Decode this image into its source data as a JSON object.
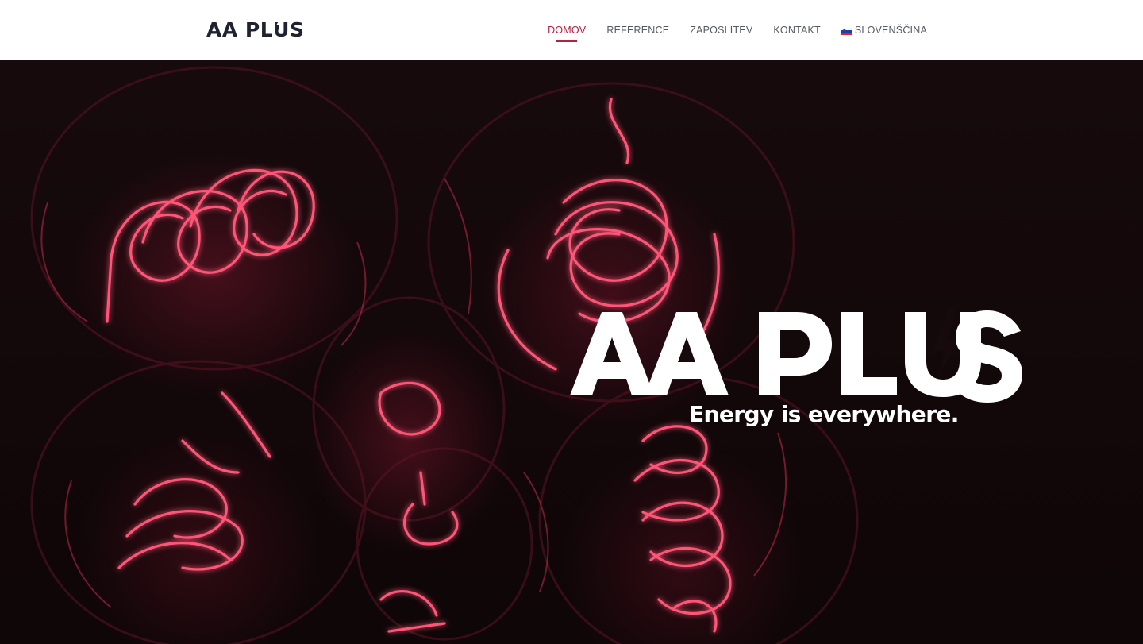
{
  "header": {
    "logo": {
      "part1": "AA PL",
      "part2": "S",
      "accent_letter": "U"
    },
    "nav": [
      {
        "label": "DOMOV",
        "active": true
      },
      {
        "label": "REFERENCE",
        "active": false
      },
      {
        "label": "ZAPOSLITEV",
        "active": false
      },
      {
        "label": "KONTAKT",
        "active": false
      },
      {
        "label": "SLOVENŠČINA",
        "active": false,
        "icon": "slovenia-flag-icon"
      }
    ]
  },
  "hero": {
    "title": "AA PLUS",
    "tagline": "Energy is everywhere.",
    "background": "glowing-lightbulb-filaments"
  },
  "colors": {
    "accent": "#b5213e",
    "nav_text": "#555a62",
    "logo_dark": "#1f2230",
    "hero_text": "#ffffff"
  }
}
